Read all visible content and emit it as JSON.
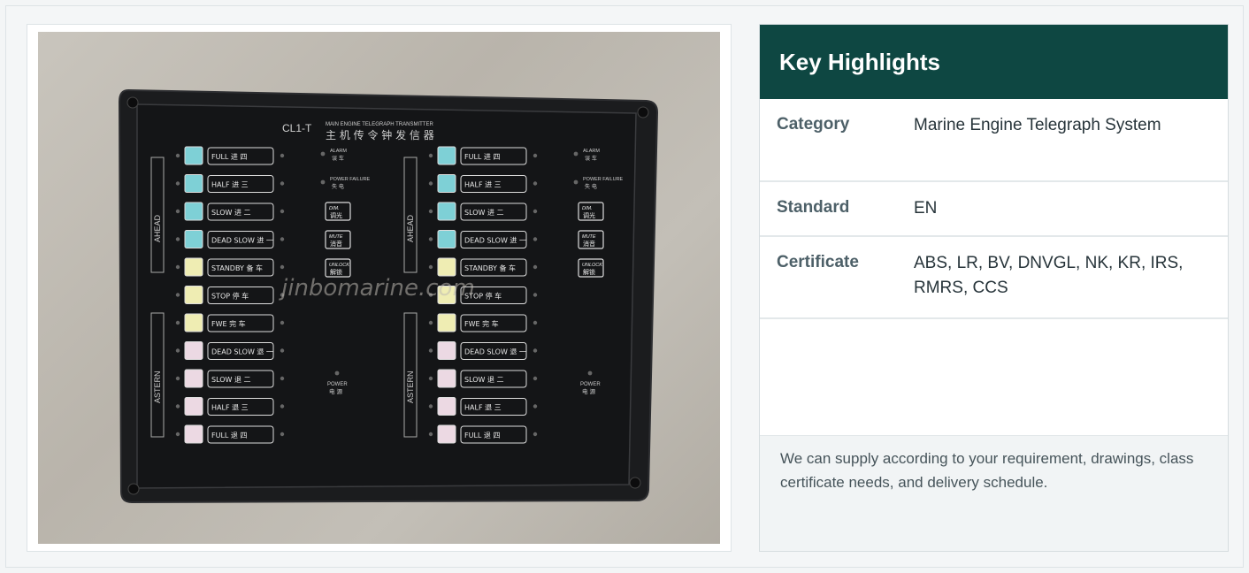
{
  "product_image": {
    "alt": "CL1-T Main Engine Telegraph Transmitter panel",
    "model": "CL1-T",
    "title_en": "MAIN ENGINE TELEGRAPH TRANSMITTER",
    "title_cn": "主 机 传 令 钟 发 信 器",
    "watermark": "jinbomarine.com",
    "side_ahead": "AHEAD",
    "side_astern": "ASTERN",
    "orders": [
      "FULL 进 四",
      "HALF 进 三",
      "SLOW 进 二",
      "DEAD SLOW 进 一",
      "STANDBY 备 车",
      "STOP 停 车",
      "FWE 完 车",
      "DEAD SLOW 退 一",
      "SLOW 退 二",
      "HALF 退 三",
      "FULL 退 四"
    ],
    "indicators": [
      {
        "en": "ALARM",
        "cn": "误 车"
      },
      {
        "en": "POWER FAILURE",
        "cn": "失 电"
      }
    ],
    "buttons": [
      {
        "en": "DIM.",
        "cn": "调光"
      },
      {
        "en": "MUTE",
        "cn": "消音"
      },
      {
        "en": "UNLOCK",
        "cn": "解锁"
      }
    ],
    "power": {
      "en": "POWER",
      "cn": "电 源"
    }
  },
  "highlights": {
    "title": "Key Highlights",
    "rows": [
      {
        "label": "Category",
        "value": "Marine Engine Telegraph System"
      },
      {
        "label": "Standard",
        "value": "EN"
      },
      {
        "label": "Certificate",
        "value": "ABS, LR, BV, DNVGL, NK, KR, IRS, RMRS, CCS"
      },
      {
        "label": "",
        "value": ""
      }
    ],
    "note": "We can supply according to your requirement, drawings, class certificate needs, and delivery schedule."
  },
  "colors": {
    "header_bg": "#0e4742",
    "lamp_cyan": "#7ed0d6",
    "lamp_yellow": "#efedb3",
    "lamp_pink": "#ecd9e3"
  }
}
